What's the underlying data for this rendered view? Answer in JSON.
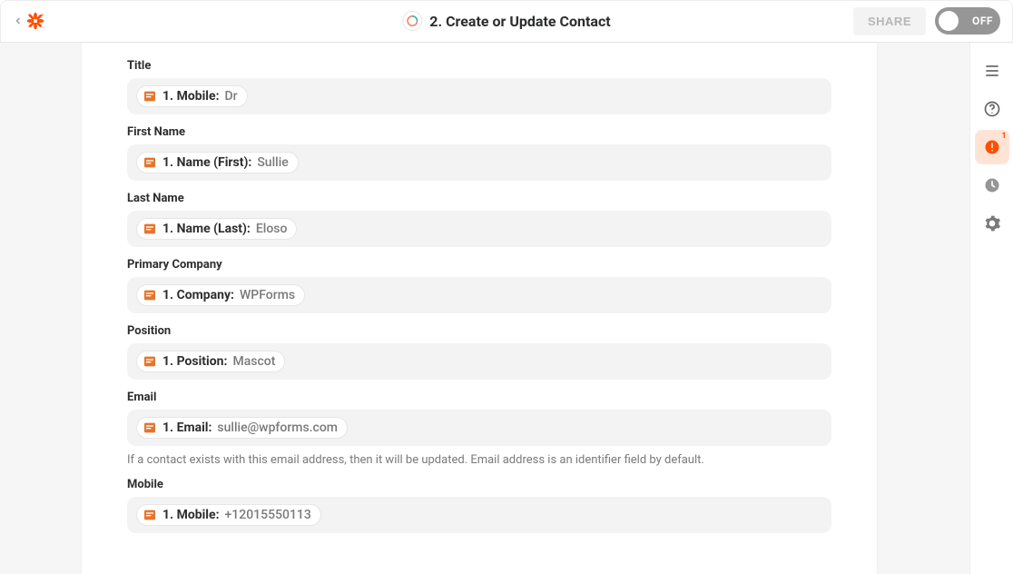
{
  "header": {
    "title": "2. Create or Update Contact",
    "share_label": "SHARE",
    "toggle_label": "OFF"
  },
  "fields": {
    "title": {
      "label": "Title",
      "pill_key": "1. Mobile:",
      "pill_value": "Dr"
    },
    "first_name": {
      "label": "First Name",
      "pill_key": "1. Name (First):",
      "pill_value": "Sullie"
    },
    "last_name": {
      "label": "Last Name",
      "pill_key": "1. Name (Last):",
      "pill_value": "Eloso"
    },
    "primary_company": {
      "label": "Primary Company",
      "pill_key": "1. Company:",
      "pill_value": "WPForms"
    },
    "position": {
      "label": "Position",
      "pill_key": "1. Position:",
      "pill_value": "Mascot"
    },
    "email": {
      "label": "Email",
      "pill_key": "1. Email:",
      "pill_value": "sullie@wpforms.com",
      "helper": "If a contact exists with this email address, then it will be updated. Email address is an identifier field by default."
    },
    "mobile": {
      "label": "Mobile",
      "pill_key": "1. Mobile:",
      "pill_value": "+12015550113"
    }
  },
  "right_rail": {
    "alert_count": "1"
  }
}
